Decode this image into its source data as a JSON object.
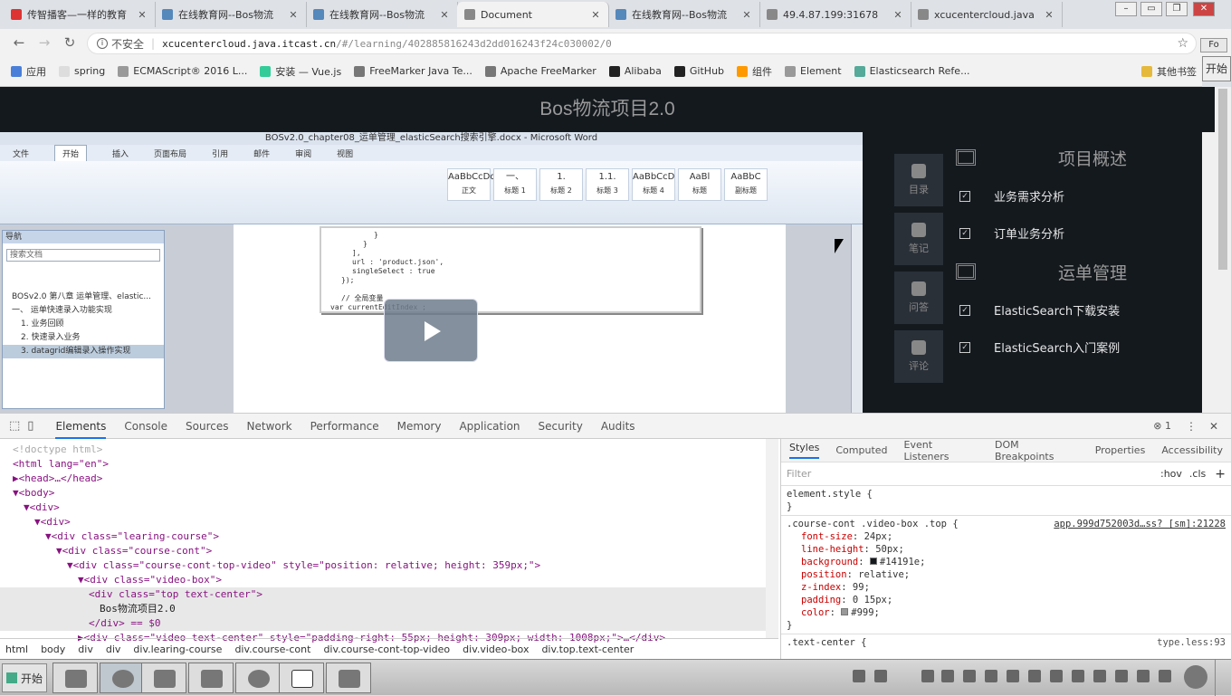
{
  "tabs": [
    {
      "title": "传智播客—一样的教育",
      "active": false
    },
    {
      "title": "在线教育网--Bos物流",
      "active": false
    },
    {
      "title": "在线教育网--Bos物流",
      "active": false
    },
    {
      "title": "Document",
      "active": true
    },
    {
      "title": "在线教育网--Bos物流",
      "active": false
    },
    {
      "title": "49.4.87.199:31678",
      "active": false
    },
    {
      "title": "xcucentercloud.java",
      "active": false
    }
  ],
  "window_buttons": [
    "Fo",
    "开始"
  ],
  "address": {
    "security": "不安全",
    "host": "xcucentercloud.java.itcast.cn",
    "path": "/#/learning/402885816243d2dd016243f24c030002/0"
  },
  "bookmarks": [
    "应用",
    "spring",
    "ECMAScript® 2016 L...",
    "安装 — Vue.js",
    "FreeMarker Java Te...",
    "Apache FreeMarker",
    "Alibaba",
    "GitHub",
    "组件",
    "Element",
    "Elasticsearch Refe..."
  ],
  "bookmarks_other": "其他书签",
  "player": {
    "title": "Bos物流项目2.0",
    "word_title": "BOSv2.0_chapter08_运单管理_elasticSearch搜索引擎.docx - Microsoft Word",
    "word_menu": [
      "文件",
      "开始",
      "插入",
      "页面布局",
      "引用",
      "邮件",
      "审阅",
      "视图"
    ],
    "word_styles": [
      "AaBbCcDd",
      "一、",
      "1.",
      "1.1.",
      "AaBbCcD",
      "AaBl",
      "AaBbC"
    ],
    "word_style_labels": [
      "正文",
      "标题 1",
      "标题 2",
      "标题 3",
      "标题 4",
      "标题",
      "副标题"
    ],
    "nav_title": "导航",
    "nav_search": "搜索文档",
    "nav_items": [
      "BOSv2.0 第八章 运单管理、elastic...",
      "一、 运单快速录入功能实现",
      "1. 业务回顾",
      "2. 快速录入业务",
      "3. datagrid编辑录入操作实现"
    ],
    "code_lines": [
      "}",
      "}",
      "],",
      "url : 'product.json',",
      "singleSelect : true",
      "});",
      "",
      "// 全局变量",
      "var currentEditIndex ;"
    ]
  },
  "side_tabs": [
    {
      "label": "目录",
      "icon": "list-icon"
    },
    {
      "label": "笔记",
      "icon": "person-icon"
    },
    {
      "label": "问答",
      "icon": "gear-icon"
    },
    {
      "label": "评论",
      "icon": "document-icon"
    }
  ],
  "outline": {
    "chapters": [
      {
        "title": "项目概述",
        "lessons": [
          "业务需求分析",
          "订单业务分析"
        ]
      },
      {
        "title": "运单管理",
        "lessons": [
          "ElasticSearch下载安装",
          "ElasticSearch入门案例"
        ]
      }
    ]
  },
  "devtools": {
    "tabs": [
      "Elements",
      "Console",
      "Sources",
      "Network",
      "Performance",
      "Memory",
      "Application",
      "Security",
      "Audits"
    ],
    "active_tab": "Elements",
    "counter": "1",
    "breadcrumb": [
      "html",
      "body",
      "div",
      "div",
      "div.learing-course",
      "div.course-cont",
      "div.course-cont-top-video",
      "div.video-box",
      "div.top.text-center"
    ],
    "styles_tabs": [
      "Styles",
      "Computed",
      "Event Listeners",
      "DOM Breakpoints",
      "Properties",
      "Accessibility"
    ],
    "filter_placeholder": "Filter",
    "filter_hov": ":hov",
    "filter_cls": ".cls",
    "element_style": "element.style {",
    "rule_selector": ".course-cont .video-box .top {",
    "rule_source": "app.999d752003d…ss? [sm]:21228",
    "rule_props": [
      {
        "name": "font-size",
        "value": "24px;"
      },
      {
        "name": "line-height",
        "value": "50px;"
      },
      {
        "name": "background",
        "value": "#14191e;"
      },
      {
        "name": "position",
        "value": "relative;"
      },
      {
        "name": "z-index",
        "value": "99;"
      },
      {
        "name": "padding",
        "value": "0 15px;"
      },
      {
        "name": "color",
        "value": "#999;"
      }
    ],
    "rule2_selector": ".text-center {",
    "rule2_source": "type.less:93"
  },
  "dom_lines": [
    {
      "depth": 0,
      "html": "<!doctype html>"
    },
    {
      "depth": 0,
      "html": "<html lang=\"en\">"
    },
    {
      "depth": 0,
      "html": "▶<head>…</head>"
    },
    {
      "depth": 0,
      "html": "▼<body>"
    },
    {
      "depth": 1,
      "html": "▼<div>"
    },
    {
      "depth": 2,
      "html": "▼<div>"
    },
    {
      "depth": 3,
      "html": "▼<div class=\"learing-course\">"
    },
    {
      "depth": 4,
      "html": "▼<div class=\"course-cont\">"
    },
    {
      "depth": 5,
      "html": "▼<div class=\"course-cont-top-video\" style=\"position: relative; height: 359px;\">"
    },
    {
      "depth": 6,
      "html": "▼<div class=\"video-box\">"
    },
    {
      "depth": 7,
      "html": "<div class=\"top text-center\">"
    },
    {
      "depth": 8,
      "html": "Bos物流项目2.0"
    },
    {
      "depth": 7,
      "html": "</div> == $0"
    },
    {
      "depth": 6,
      "html": "▶<div class=\"video text-center\" style=\"padding-right: 55px; height: 309px; width: 1008px;\">…</div>"
    }
  ],
  "taskbar": {
    "start": "开始"
  },
  "colors": {
    "player_bg": "#14191e",
    "title_color": "#999",
    "devtools_accent": "#1a73e8"
  }
}
